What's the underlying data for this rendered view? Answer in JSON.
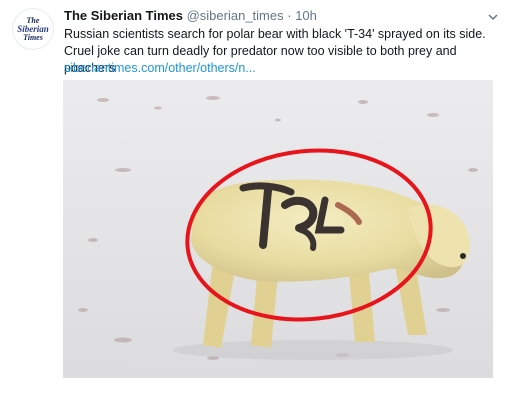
{
  "avatar": {
    "line1": "The",
    "line2": "Siberian",
    "line3": "Times"
  },
  "tweet": {
    "display_name": "The Siberian Times",
    "handle": "@siberian_times",
    "separator": "·",
    "timestamp": "10h",
    "text": "Russian scientists search for polar bear with black 'T-34' sprayed on its side. Cruel joke can turn deadly for predator now too visible to both prey and poachers",
    "link": "siberiantimes.com/other/others/n..."
  },
  "media": {
    "description_icon": "polar-bear-photo",
    "annotation_color": "#e8141c"
  }
}
